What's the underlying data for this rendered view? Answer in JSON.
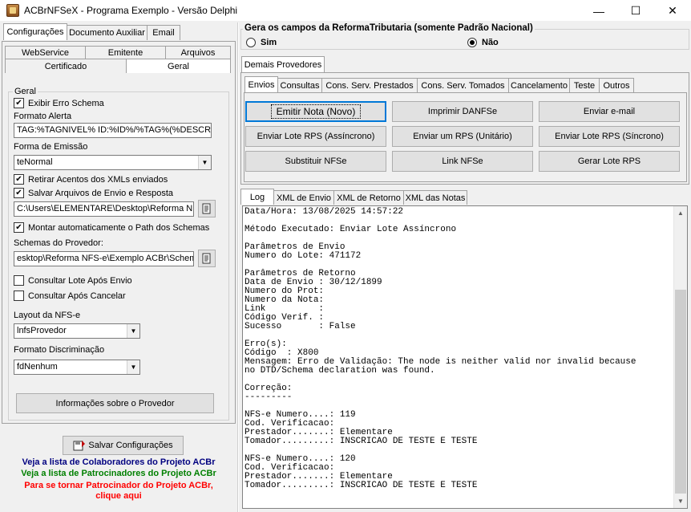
{
  "window": {
    "title": "ACBrNFSeX - Programa Exemplo - Versão Delphi",
    "controls": {
      "minimize": "—",
      "maximize": "☐",
      "close": "✕"
    }
  },
  "left": {
    "tabs_row1": [
      "Configurações",
      "Documento Auxiliar",
      "Email"
    ],
    "tabs_row2": [
      "WebService",
      "Emitente",
      "Arquivos"
    ],
    "tabs_row3": [
      "Certificado",
      "Geral"
    ],
    "group_title": "Geral",
    "exibir_erro_schema": {
      "label": "Exibir Erro Schema",
      "checked": true
    },
    "formato_alerta": {
      "label": "Formato Alerta",
      "value": "TAG:%TAGNIVEL% ID:%ID%/%TAG%(%DESCRI"
    },
    "forma_emissao": {
      "label": "Forma de Emissão",
      "value": "teNormal"
    },
    "retirar_acentos": {
      "label": "Retirar Acentos dos XMLs enviados",
      "checked": true
    },
    "salvar_arquivos": {
      "label": "Salvar Arquivos de Envio e Resposta",
      "checked": true
    },
    "path_salvar": "C:\\Users\\ELEMENTARE\\Desktop\\Reforma NFS-",
    "montar_path": {
      "label": "Montar automaticamente o Path dos Schemas",
      "checked": true
    },
    "schemas_provedor": {
      "label": "Schemas do Provedor:",
      "value": "esktop\\Reforma NFS-e\\Exemplo ACBr\\Schemas"
    },
    "consultar_lote": {
      "label": "Consultar Lote Após Envio",
      "checked": false
    },
    "consultar_cancelar": {
      "label": "Consultar Após Cancelar",
      "checked": false
    },
    "layout_nfse": {
      "label": "Layout da NFS-e",
      "value": "lnfsProvedor"
    },
    "formato_discriminacao": {
      "label": "Formato Discriminação",
      "value": "fdNenhum"
    },
    "info_provedor_btn": "Informações sobre o Provedor",
    "salvar_config_btn": "Salvar Configurações",
    "links": [
      {
        "text": "Veja a lista de Colaboradores do Projeto ACBr",
        "color": "#000080"
      },
      {
        "text": "Veja a lista de Patrocinadores do Projeto ACBr",
        "color": "#008000"
      },
      {
        "text": "Para se tornar Patrocinador do Projeto ACBr,",
        "color": "#ff0000"
      },
      {
        "text": "clique aqui",
        "color": "#ff0000"
      }
    ]
  },
  "right": {
    "reforma_title": "Gera os campos da ReformaTributaria (somente Padrão Nacional)",
    "radio_sim": {
      "label": "Sim",
      "selected": false
    },
    "radio_nao": {
      "label": "Não",
      "selected": true
    },
    "provider_tab": "Demais Provedores",
    "action_tabs": [
      "Envios",
      "Consultas",
      "Cons. Serv. Prestados",
      "Cons. Serv. Tomados",
      "Cancelamento",
      "Teste",
      "Outros"
    ],
    "buttons": [
      [
        "Emitir Nota (Novo)",
        "Imprimir DANFSe",
        "Enviar e-mail"
      ],
      [
        "Enviar Lote RPS (Assíncrono)",
        "Enviar um RPS (Unitário)",
        "Enviar Lote RPS (Síncrono)"
      ],
      [
        "Substituir NFSe",
        "Link NFSe",
        "Gerar Lote RPS"
      ]
    ],
    "log_tabs": [
      "Log",
      "XML de Envio",
      "XML de Retorno",
      "XML das Notas"
    ],
    "log_lines": [
      "Data/Hora: 13/08/2025 14:57:22",
      "",
      "Método Executado: Enviar Lote Assíncrono",
      "",
      "Parâmetros de Envio",
      "Numero do Lote: 471172",
      "",
      "Parâmetros de Retorno",
      "Data de Envio : 30/12/1899",
      "Numero do Prot:",
      "Numero da Nota:",
      "Link          :",
      "Código Verif. :",
      "Sucesso       : False",
      "",
      "Erro(s):",
      "Código  : X800",
      "Mensagem: Erro de Validação: The node is neither valid nor invalid because",
      "no DTD/Schema declaration was found.",
      "",
      "Correção:",
      "---------",
      "",
      "NFS-e Numero....: 119",
      "Cod. Verificacao:",
      "Prestador.......: Elementare",
      "Tomador.........: INSCRICAO DE TESTE E TESTE",
      "",
      "NFS-e Numero....: 120",
      "Cod. Verificacao:",
      "Prestador.......: Elementare",
      "Tomador.........: INSCRICAO DE TESTE E TESTE"
    ]
  }
}
